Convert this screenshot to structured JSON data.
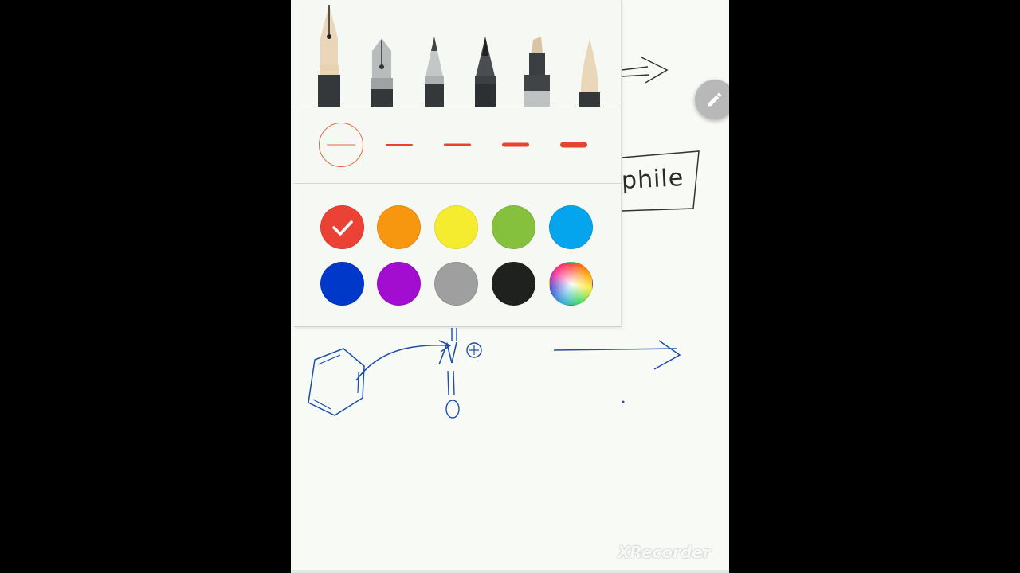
{
  "canvas": {
    "handwritten_label": "phile",
    "watermark": "XRecorder",
    "background": "#f8faf6"
  },
  "pen_tools": [
    {
      "name": "fountain-pen",
      "icon": "fountain-pen-icon",
      "selected": true
    },
    {
      "name": "calligraphy-pen",
      "icon": "calligraphy-pen-icon",
      "selected": false
    },
    {
      "name": "pencil",
      "icon": "pencil-icon",
      "selected": false
    },
    {
      "name": "brush-pen",
      "icon": "brush-pen-icon",
      "selected": false
    },
    {
      "name": "marker",
      "icon": "marker-icon",
      "selected": false
    },
    {
      "name": "chisel-brush",
      "icon": "chisel-brush-icon",
      "selected": false
    }
  ],
  "thickness_levels": [
    1,
    2,
    3,
    4,
    5
  ],
  "thickness_selected_index": 0,
  "pen_color": "#e8432e",
  "colors": [
    {
      "name": "red",
      "hex": "#ea4335",
      "selected": true
    },
    {
      "name": "orange",
      "hex": "#f7960f",
      "selected": false
    },
    {
      "name": "yellow",
      "hex": "#f6ec2f",
      "selected": false
    },
    {
      "name": "green",
      "hex": "#86c13e",
      "selected": false
    },
    {
      "name": "sky-blue",
      "hex": "#04a5ec",
      "selected": false
    },
    {
      "name": "blue",
      "hex": "#0039c9",
      "selected": false
    },
    {
      "name": "purple",
      "hex": "#a30dcf",
      "selected": false
    },
    {
      "name": "gray",
      "hex": "#9e9f9e",
      "selected": false
    },
    {
      "name": "black",
      "hex": "#1f211f",
      "selected": false
    },
    {
      "name": "custom-color",
      "hex": "rainbow",
      "selected": false
    }
  ],
  "icons": {
    "pen_fab": "pencil-icon",
    "selected_check": "checkmark-icon"
  }
}
